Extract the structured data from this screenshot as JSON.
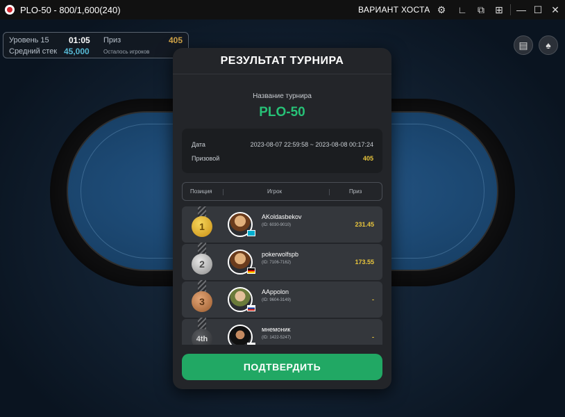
{
  "titlebar": {
    "title": "PLO-50 - 800/1,600(240)",
    "host_variant": "ВАРИАНТ ХОСТА"
  },
  "info_panel": {
    "level_label": "Уровень 15",
    "timer": "01:05",
    "prize_label": "Приз",
    "prize_value": "405",
    "avg_stack_label": "Средний стек",
    "avg_stack_value": "45,000",
    "players_left_label": "Осталось игроков"
  },
  "modal": {
    "title": "РЕЗУЛЬТАТ ТУРНИРА",
    "tournament_name_label": "Название турнира",
    "tournament_name": "PLO-50",
    "date_label": "Дата",
    "date_value": "2023-08-07 22:59:58 ~ 2023-08-08 00:17:24",
    "prize_label": "Призовой",
    "prize_value": "405",
    "columns": {
      "position": "Позиция",
      "player": "Игрок",
      "prize": "Приз"
    },
    "results": [
      {
        "place": "1",
        "name": "AKoldasbekov",
        "id": "(ID: 6030-9010)",
        "prize": "231.45",
        "flag": "kz"
      },
      {
        "place": "2",
        "name": "pokerwolfspb",
        "id": "(ID: 7106-7162)",
        "prize": "173.55",
        "flag": "de"
      },
      {
        "place": "3",
        "name": "AAppolon",
        "id": "(ID: 9604-3149)",
        "prize": "-",
        "flag": "ru"
      },
      {
        "place": "4th",
        "name": "мнемоник",
        "id": "(ID: 1422-5247)",
        "prize": "-",
        "flag": "ru"
      }
    ],
    "confirm_label": "ПОДТВЕРДИТЬ"
  },
  "colors": {
    "accent_green": "#21a864",
    "tournament_name_green": "#27c177",
    "prize_gold": "#e8c53c"
  }
}
